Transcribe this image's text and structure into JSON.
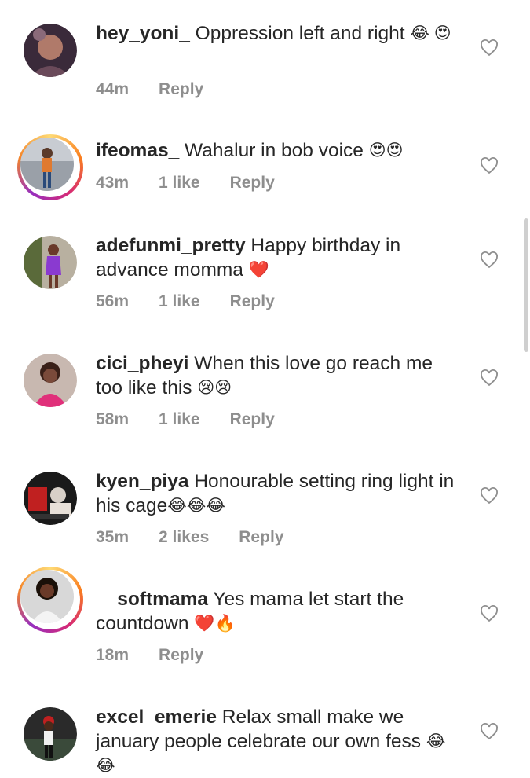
{
  "comments": [
    {
      "username": "hey_yoni_",
      "text": "Oppression left and right ",
      "emojis": "😂 😍",
      "time": "44m",
      "likes": "",
      "reply": "Reply",
      "story": false
    },
    {
      "username": "ifeomas_",
      "text": "Wahalur in bob voice ",
      "emojis": "😍😍",
      "time": "43m",
      "likes": "1 like",
      "reply": "Reply",
      "story": true
    },
    {
      "username": "adefunmi_pretty",
      "text": "Happy birthday in advance momma ",
      "emojis": "❤️",
      "time": "56m",
      "likes": "1 like",
      "reply": "Reply",
      "story": false
    },
    {
      "username": "cici_pheyi",
      "text": "When this love go reach me too like this ",
      "emojis": "😢😢",
      "time": "58m",
      "likes": "1 like",
      "reply": "Reply",
      "story": false
    },
    {
      "username": "kyen_piya",
      "text": "Honourable setting ring light in his cage",
      "emojis": "😂😂😂",
      "time": "35m",
      "likes": "2 likes",
      "reply": "Reply",
      "story": false
    },
    {
      "username": "__softmama",
      "text": "Yes mama let start the countdown ",
      "emojis": "❤️🔥",
      "time": "18m",
      "likes": "",
      "reply": "Reply",
      "story": true
    },
    {
      "username": "excel_emerie",
      "text": "Relax small make we january people celebrate our own fess ",
      "emojis": "😂😂",
      "time": "",
      "likes": "",
      "reply": "",
      "story": false
    }
  ],
  "icons": {
    "like": "heart-outline-icon"
  },
  "colors": {
    "text": "#262626",
    "meta": "#8e8e8e",
    "heart": "#8e8e8e"
  }
}
